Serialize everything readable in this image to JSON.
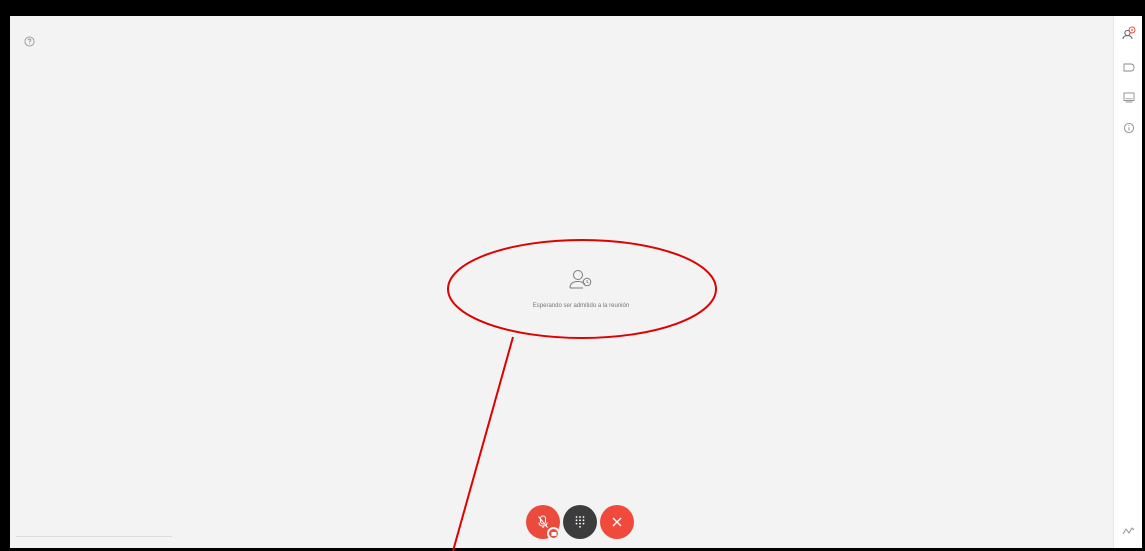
{
  "meeting": {
    "status_text": "Esperando ser admitido a la reunión"
  },
  "icons": {
    "help": "help-icon",
    "participants": "participants-icon",
    "chat": "chat-icon",
    "screen": "screen-share-icon",
    "info": "info-icon",
    "waiting": "waiting-person-icon",
    "mute": "microphone-muted-icon",
    "keypad": "keypad-icon",
    "hangup": "close-icon",
    "stats": "signal-stats-icon"
  },
  "colors": {
    "stage_background": "#f3f3f3",
    "accent_red": "#ea4b3c",
    "keypad_dark": "#3c3c3c",
    "annotation_red": "#e00000"
  }
}
